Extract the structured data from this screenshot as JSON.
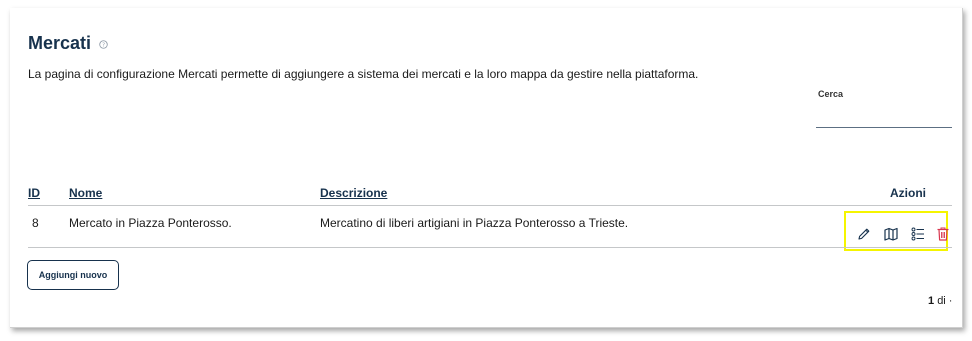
{
  "page": {
    "title": "Mercati",
    "description": "La pagina di configurazione Mercati permette di aggiungere a sistema dei mercati e la loro mappa da gestire nella piattaforma."
  },
  "search": {
    "label": "Cerca",
    "placeholder": "",
    "value": ""
  },
  "table": {
    "headers": {
      "id": "ID",
      "name": "Nome",
      "description": "Descrizione",
      "actions": "Azioni"
    },
    "rows": [
      {
        "id": "8",
        "name": "Mercato in Piazza Ponterosso.",
        "description": "Mercatino di liberi artigiani in Piazza Ponterosso a Trieste."
      }
    ],
    "row_actions": [
      "pencil-icon",
      "map-icon",
      "list-icon",
      "trash-icon"
    ]
  },
  "add_button_label": "Aggiungi nuovo",
  "pagination": {
    "current": "1",
    "suffix": "di ·"
  },
  "colors": {
    "primary": "#17324d",
    "danger": "#d9364f",
    "highlight": "#f5f500"
  }
}
